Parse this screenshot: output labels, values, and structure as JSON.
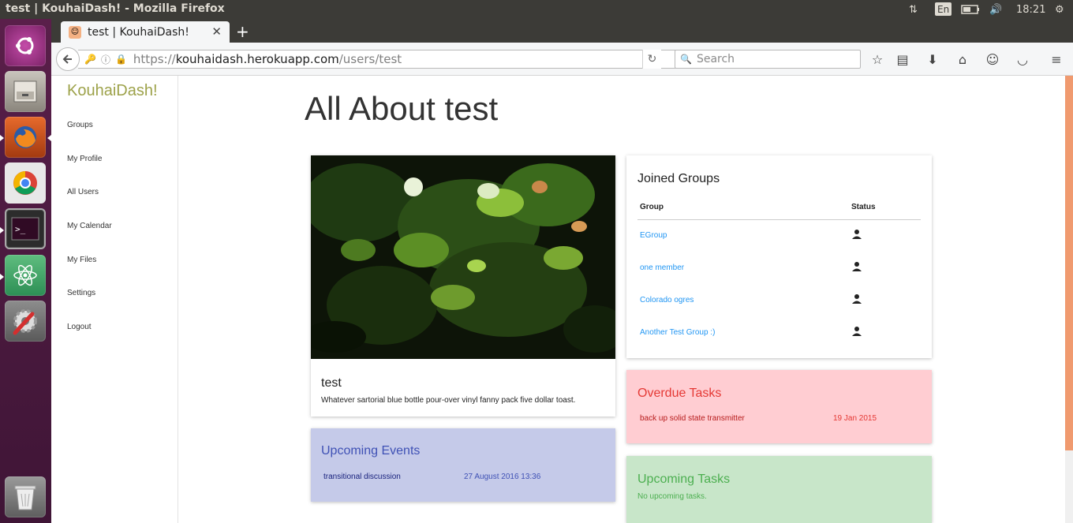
{
  "window": {
    "title": "test | KouhaiDash! - Mozilla Firefox"
  },
  "panel": {
    "language": "En",
    "clock": "18:21"
  },
  "launcher": {
    "items": [
      "ubuntu-dash-icon",
      "files-icon",
      "firefox-icon",
      "chrome-icon",
      "terminal-icon",
      "atom-icon",
      "system-settings-icon",
      "trash-icon"
    ]
  },
  "browser": {
    "tab_title": "test | KouhaiDash!",
    "url_scheme": "https://",
    "url_host": "kouhaidash.herokuapp.com",
    "url_path": "/users/test",
    "search_placeholder": "Search"
  },
  "sidebar": {
    "brand": "KouhaiDash!",
    "items": [
      {
        "label": "Groups"
      },
      {
        "label": "My Profile"
      },
      {
        "label": "All Users"
      },
      {
        "label": "My Calendar"
      },
      {
        "label": "My Files"
      },
      {
        "label": "Settings"
      },
      {
        "label": "Logout"
      }
    ]
  },
  "main": {
    "heading": "All About test",
    "profile": {
      "name": "test",
      "bio": "Whatever sartorial blue bottle pour-over vinyl fanny pack five dollar toast."
    },
    "upcoming_events": {
      "title": "Upcoming Events",
      "items": [
        {
          "name": "transitional discussion",
          "date": "27 August 2016 13:36"
        }
      ]
    },
    "joined_groups": {
      "title": "Joined Groups",
      "columns": [
        "Group",
        "Status"
      ],
      "rows": [
        {
          "group": "EGroup",
          "status_icon": "person-icon"
        },
        {
          "group": "one member",
          "status_icon": "person-icon"
        },
        {
          "group": "Colorado ogres",
          "status_icon": "person-icon"
        },
        {
          "group": "Another Test Group :)",
          "status_icon": "person-icon"
        }
      ]
    },
    "overdue_tasks": {
      "title": "Overdue Tasks",
      "items": [
        {
          "name": "back up solid state transmitter",
          "date": "19 Jan 2015"
        }
      ]
    },
    "upcoming_tasks": {
      "title": "Upcoming Tasks",
      "empty_text": "No upcoming tasks."
    }
  }
}
